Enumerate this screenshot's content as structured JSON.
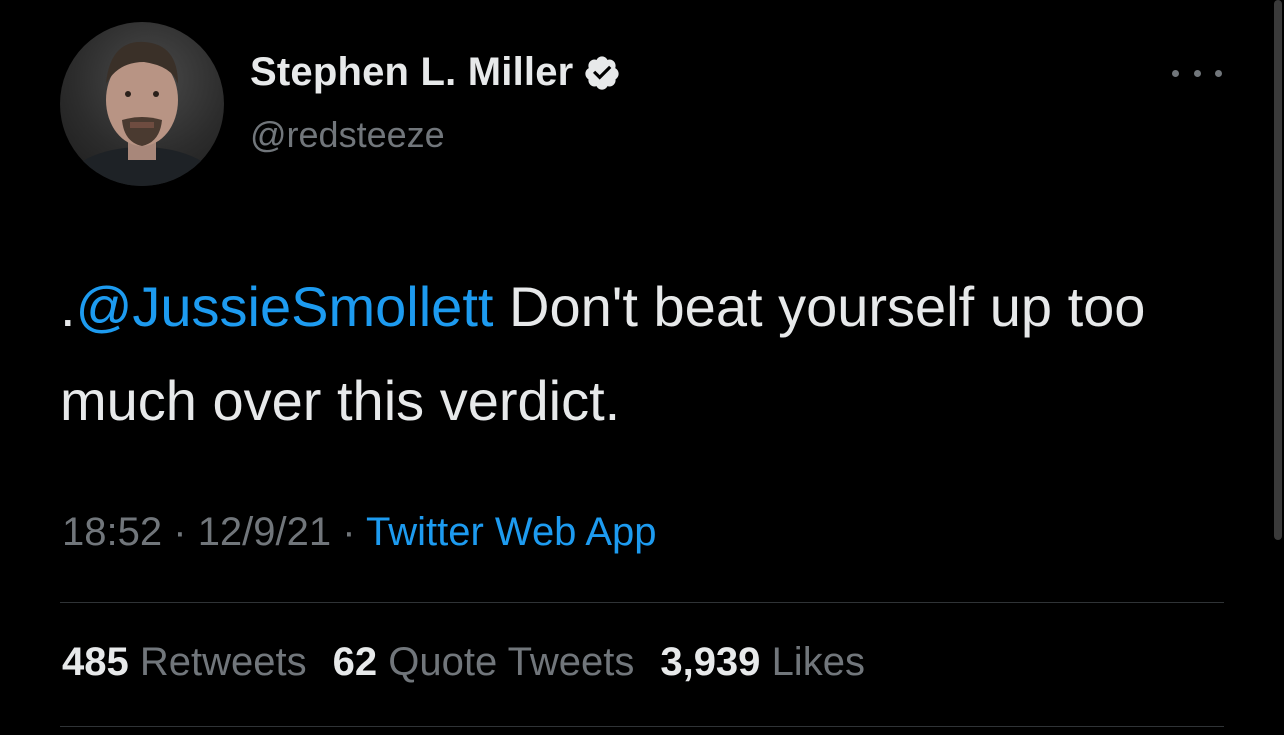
{
  "tweet": {
    "author": {
      "display_name": "Stephen L. Miller",
      "handle": "@redsteeze",
      "verified_icon": "verified-badge-icon",
      "avatar_icon": "profile-photo"
    },
    "more_icon": "more-dots-icon",
    "text": {
      "prefix": ".",
      "mention": "@JussieSmollett",
      "body": " Don't beat yourself up too much over this verdict."
    },
    "meta": {
      "time": "18:52",
      "separator": "·",
      "date": "12/9/21",
      "source": "Twitter Web App"
    },
    "stats": {
      "retweets_count": "485",
      "retweets_label": "Retweets",
      "quotes_count": "62",
      "quotes_label": "Quote Tweets",
      "likes_count": "3,939",
      "likes_label": "Likes"
    }
  },
  "colors": {
    "background": "#000000",
    "primary_text": "#e7e9ea",
    "secondary_text": "#71767b",
    "link": "#1d9bf0",
    "divider": "#2f3336"
  }
}
